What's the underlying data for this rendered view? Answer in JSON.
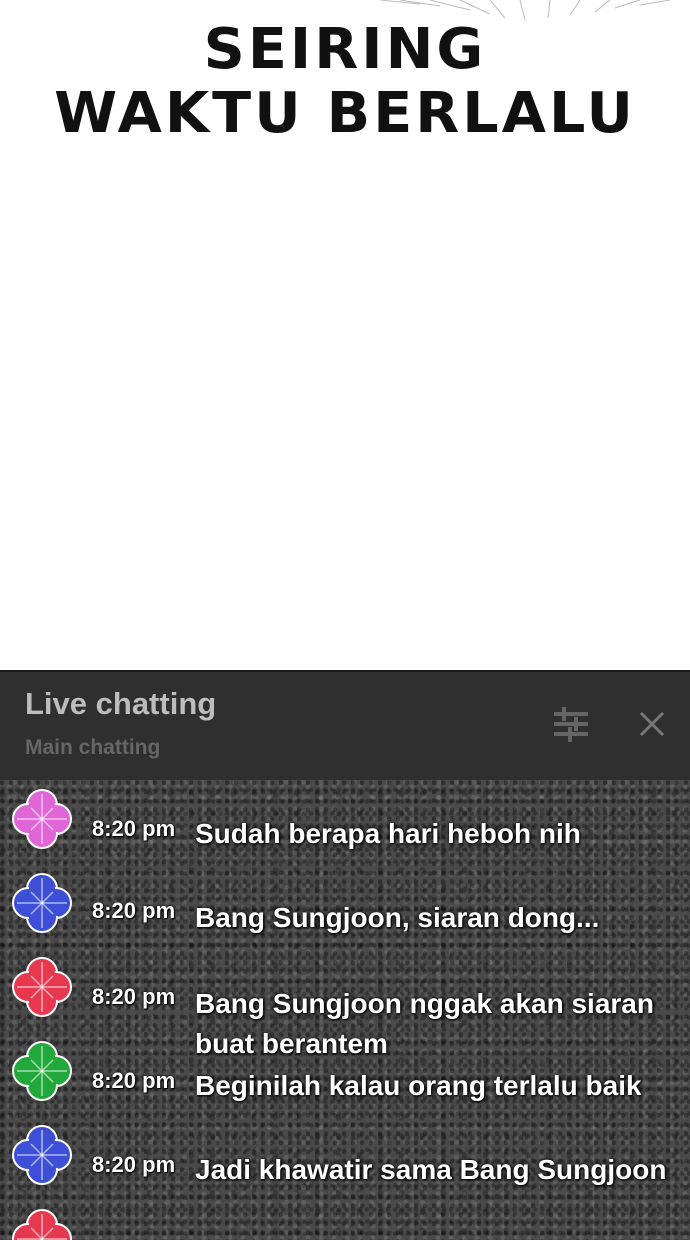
{
  "caption": {
    "line1": "SEIRING",
    "line2": "WAKTU BERLALU"
  },
  "chat": {
    "title": "Live chatting",
    "subtitle": "Main chatting",
    "messages": [
      {
        "time": "8:20 pm",
        "text": "Sudah berapa hari heboh nih",
        "avatar_color": "#e066d8"
      },
      {
        "time": "8:20 pm",
        "text": "Bang Sungjoon, siaran dong...",
        "avatar_color": "#3d4fd6"
      },
      {
        "time": "8:20 pm",
        "text": "Bang Sungjoon nggak akan siaran buat berantem",
        "avatar_color": "#e8384f"
      },
      {
        "time": "8:20 pm",
        "text": "Beginilah kalau orang terlalu baik",
        "avatar_color": "#22a83a"
      },
      {
        "time": "8:20 pm",
        "text": "Jadi khawatir sama Bang Sungjoon",
        "avatar_color": "#3d4fd6"
      },
      {
        "time": "",
        "text": "",
        "avatar_color": "#e8384f"
      }
    ]
  },
  "icons": {
    "filter": "filter-sliders-icon",
    "close": "close-icon",
    "avatar": "clover-flower-icon"
  },
  "colors": {
    "header_bg": "#2f2f2f",
    "title_text": "#bdbdbd",
    "subtitle_text": "#666666",
    "message_text": "#ffffff"
  }
}
